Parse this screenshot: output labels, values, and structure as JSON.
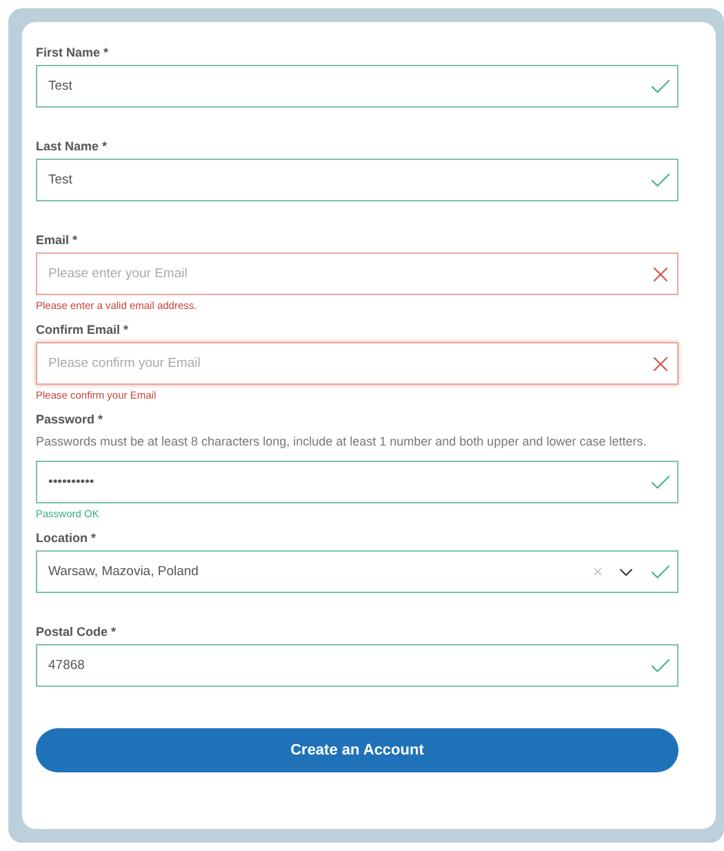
{
  "fields": [
    {
      "kind": "text",
      "label": "First Name *",
      "value": "Test",
      "valid": true
    },
    {
      "kind": "text",
      "label": "Last Name *",
      "value": "Test",
      "valid": true
    },
    {
      "kind": "text",
      "label": "Email *",
      "placeholder": "Please enter your Email",
      "valid": false,
      "message": "Please enter a valid email address."
    },
    {
      "kind": "text",
      "label": "Confirm Email *",
      "placeholder": "Please confirm your Email",
      "valid": false,
      "focused": true,
      "message": "Please confirm your Email"
    },
    {
      "kind": "text",
      "label": "Password *",
      "help": "Passwords must be at least 8 characters long, include at least 1 number and both upper and lower case letters.",
      "value": "••••••••••",
      "valid": true,
      "message": "Password OK"
    },
    {
      "kind": "select",
      "label": "Location *",
      "value": "Warsaw, Mazovia, Poland",
      "valid": true
    },
    {
      "kind": "text",
      "label": "Postal Code *",
      "value": "47868",
      "valid": true
    }
  ],
  "submit": {
    "label": "Create an Account"
  }
}
